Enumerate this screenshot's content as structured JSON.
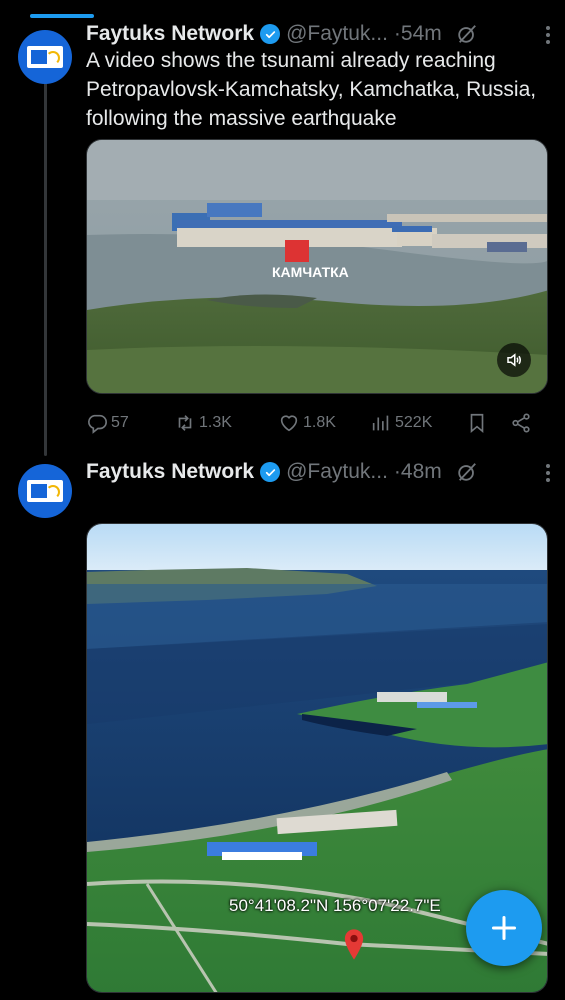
{
  "tweets": [
    {
      "author_name": "Faytuks Network",
      "handle": "@Faytuk...",
      "time": "·54m",
      "text": "A video shows the tsunami already reaching Petropavlovsk-Kamchatsky, Kamchatka, Russia, following the massive earthquake",
      "media_watermark": "КАМЧАТКА",
      "stats": {
        "replies": "57",
        "reposts": "1.3K",
        "likes": "1.8K",
        "views": "522K"
      }
    },
    {
      "author_name": "Faytuks Network",
      "handle": "@Faytuk...",
      "time": "·48m",
      "map_coordinates": "50°41'08.2\"N 156°07'22.7\"E"
    }
  ],
  "colors": {
    "accent": "#1d9bf0",
    "background": "#000000",
    "muted": "#71767b",
    "text": "#e7e9ea"
  },
  "icons": [
    "verified-badge-icon",
    "grok-icon",
    "more-icon",
    "reply-icon",
    "repost-icon",
    "like-icon",
    "views-icon",
    "bookmark-icon",
    "share-icon",
    "sound-icon",
    "map-pin-icon",
    "plus-icon"
  ]
}
